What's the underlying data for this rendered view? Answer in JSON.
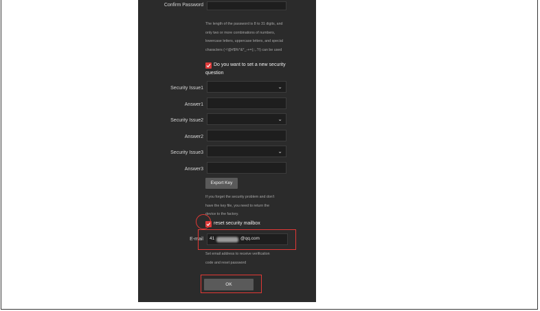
{
  "form": {
    "confirm_password_label": "Confirm Password",
    "password_hint_lines": [
      "The length of the password is 8 to 31 digits, and",
      "only two or more combinations of numbers,",
      "lowercase letters, uppercase letters, and special",
      "characters (~!@#$%^&*_-+=|;:,.?/) can be used"
    ],
    "security_question_checkbox": {
      "checked": true,
      "label_line1": "Do you want to set a new security",
      "label_line2": "question"
    },
    "security_issue1_label": "Security Issue1",
    "answer1_label": "Answer1",
    "security_issue2_label": "Security Issue2",
    "answer2_label": "Answer2",
    "security_issue3_label": "Security Issue3",
    "answer3_label": "Answer3",
    "export_key_label": "Export Key",
    "key_hint_lines": [
      "If you forget the security problem and don't",
      "have the key file, you need to return the",
      "device to the factory."
    ],
    "reset_mailbox_checkbox": {
      "checked": true,
      "label": "reset security mailbox"
    },
    "email_label": "E-mail",
    "email_value_prefix": "41",
    "email_value_suffix": "@qq.com",
    "email_hint_lines": [
      "Set email address to receive verification",
      "code and reset password"
    ],
    "ok_label": "OK"
  },
  "colors": {
    "panel_bg": "#2b2b2b",
    "input_bg": "#1e1e1e",
    "checkbox_accent": "#e03b3b",
    "annotation_red": "#e53935",
    "button_bg": "#5a5a5a"
  }
}
